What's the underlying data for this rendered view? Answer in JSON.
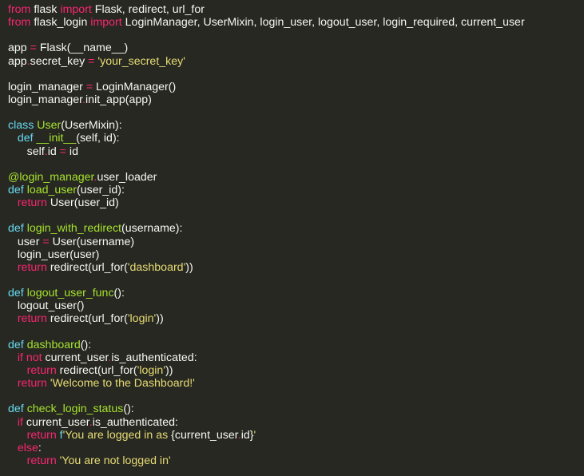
{
  "theme": {
    "background": "#272822",
    "token_colors": {
      "plain": "#f8f8f2",
      "keyword": "#f92672",
      "storage": "#66d9ef",
      "function": "#a6e22e",
      "string": "#e6db74"
    }
  },
  "code": {
    "lines": [
      [
        {
          "t": "from",
          "k": "keyword"
        },
        {
          "t": " flask ",
          "k": "plain"
        },
        {
          "t": "import",
          "k": "keyword"
        },
        {
          "t": " Flask, redirect, url_for",
          "k": "plain"
        }
      ],
      [
        {
          "t": "from",
          "k": "keyword"
        },
        {
          "t": " flask_login ",
          "k": "plain"
        },
        {
          "t": "import",
          "k": "keyword"
        },
        {
          "t": " LoginManager, UserMixin, login_user, logout_user, login_required, current_user",
          "k": "plain"
        }
      ],
      [],
      [
        {
          "t": "app ",
          "k": "plain"
        },
        {
          "t": "=",
          "k": "keyword"
        },
        {
          "t": " Flask(__name__)",
          "k": "plain"
        }
      ],
      [
        {
          "t": "app",
          "k": "plain"
        },
        {
          "t": ".",
          "k": "keyword"
        },
        {
          "t": "secret_key ",
          "k": "plain"
        },
        {
          "t": "=",
          "k": "keyword"
        },
        {
          "t": " ",
          "k": "plain"
        },
        {
          "t": "'your_secret_key'",
          "k": "string"
        }
      ],
      [],
      [
        {
          "t": "login_manager ",
          "k": "plain"
        },
        {
          "t": "=",
          "k": "keyword"
        },
        {
          "t": " LoginManager()",
          "k": "plain"
        }
      ],
      [
        {
          "t": "login_manager",
          "k": "plain"
        },
        {
          "t": ".",
          "k": "keyword"
        },
        {
          "t": "init_app(app)",
          "k": "plain"
        }
      ],
      [],
      [
        {
          "t": "class",
          "k": "storage"
        },
        {
          "t": " ",
          "k": "plain"
        },
        {
          "t": "User",
          "k": "function"
        },
        {
          "t": "(UserMixin):",
          "k": "plain"
        }
      ],
      [
        {
          "t": "   ",
          "k": "plain"
        },
        {
          "t": "def",
          "k": "storage"
        },
        {
          "t": " ",
          "k": "plain"
        },
        {
          "t": "__init__",
          "k": "function"
        },
        {
          "t": "(self, id):",
          "k": "plain"
        }
      ],
      [
        {
          "t": "      self",
          "k": "plain"
        },
        {
          "t": ".",
          "k": "keyword"
        },
        {
          "t": "id ",
          "k": "plain"
        },
        {
          "t": "=",
          "k": "keyword"
        },
        {
          "t": " id",
          "k": "plain"
        }
      ],
      [],
      [
        {
          "t": "@login_manager",
          "k": "function"
        },
        {
          "t": ".",
          "k": "keyword"
        },
        {
          "t": "user_loader",
          "k": "plain"
        }
      ],
      [
        {
          "t": "def",
          "k": "storage"
        },
        {
          "t": " ",
          "k": "plain"
        },
        {
          "t": "load_user",
          "k": "function"
        },
        {
          "t": "(user_id):",
          "k": "plain"
        }
      ],
      [
        {
          "t": "   ",
          "k": "plain"
        },
        {
          "t": "return",
          "k": "keyword"
        },
        {
          "t": " User(user_id)",
          "k": "plain"
        }
      ],
      [],
      [
        {
          "t": "def",
          "k": "storage"
        },
        {
          "t": " ",
          "k": "plain"
        },
        {
          "t": "login_with_redirect",
          "k": "function"
        },
        {
          "t": "(username):",
          "k": "plain"
        }
      ],
      [
        {
          "t": "   user ",
          "k": "plain"
        },
        {
          "t": "=",
          "k": "keyword"
        },
        {
          "t": " User(username)",
          "k": "plain"
        }
      ],
      [
        {
          "t": "   login_user(user)",
          "k": "plain"
        }
      ],
      [
        {
          "t": "   ",
          "k": "plain"
        },
        {
          "t": "return",
          "k": "keyword"
        },
        {
          "t": " redirect(url_for(",
          "k": "plain"
        },
        {
          "t": "'dashboard'",
          "k": "string"
        },
        {
          "t": "))",
          "k": "plain"
        }
      ],
      [],
      [
        {
          "t": "def",
          "k": "storage"
        },
        {
          "t": " ",
          "k": "plain"
        },
        {
          "t": "logout_user_func",
          "k": "function"
        },
        {
          "t": "():",
          "k": "plain"
        }
      ],
      [
        {
          "t": "   logout_user()",
          "k": "plain"
        }
      ],
      [
        {
          "t": "   ",
          "k": "plain"
        },
        {
          "t": "return",
          "k": "keyword"
        },
        {
          "t": " redirect(url_for(",
          "k": "plain"
        },
        {
          "t": "'login'",
          "k": "string"
        },
        {
          "t": "))",
          "k": "plain"
        }
      ],
      [],
      [
        {
          "t": "def",
          "k": "storage"
        },
        {
          "t": " ",
          "k": "plain"
        },
        {
          "t": "dashboard",
          "k": "function"
        },
        {
          "t": "():",
          "k": "plain"
        }
      ],
      [
        {
          "t": "   ",
          "k": "plain"
        },
        {
          "t": "if",
          "k": "keyword"
        },
        {
          "t": " ",
          "k": "plain"
        },
        {
          "t": "not",
          "k": "keyword"
        },
        {
          "t": " current_user",
          "k": "plain"
        },
        {
          "t": ".",
          "k": "keyword"
        },
        {
          "t": "is_authenticated:",
          "k": "plain"
        }
      ],
      [
        {
          "t": "      ",
          "k": "plain"
        },
        {
          "t": "return",
          "k": "keyword"
        },
        {
          "t": " redirect(url_for(",
          "k": "plain"
        },
        {
          "t": "'login'",
          "k": "string"
        },
        {
          "t": "))",
          "k": "plain"
        }
      ],
      [
        {
          "t": "   ",
          "k": "plain"
        },
        {
          "t": "return",
          "k": "keyword"
        },
        {
          "t": " ",
          "k": "plain"
        },
        {
          "t": "'Welcome to the Dashboard!'",
          "k": "string"
        }
      ],
      [],
      [
        {
          "t": "def",
          "k": "storage"
        },
        {
          "t": " ",
          "k": "plain"
        },
        {
          "t": "check_login_status",
          "k": "function"
        },
        {
          "t": "():",
          "k": "plain"
        }
      ],
      [
        {
          "t": "   ",
          "k": "plain"
        },
        {
          "t": "if",
          "k": "keyword"
        },
        {
          "t": " current_user",
          "k": "plain"
        },
        {
          "t": ".",
          "k": "keyword"
        },
        {
          "t": "is_authenticated:",
          "k": "plain"
        }
      ],
      [
        {
          "t": "      ",
          "k": "plain"
        },
        {
          "t": "return",
          "k": "keyword"
        },
        {
          "t": " ",
          "k": "plain"
        },
        {
          "t": "f",
          "k": "storage"
        },
        {
          "t": "'You are logged in as ",
          "k": "string"
        },
        {
          "t": "{current_user",
          "k": "plain"
        },
        {
          "t": ".",
          "k": "keyword"
        },
        {
          "t": "id}",
          "k": "plain"
        },
        {
          "t": "'",
          "k": "string"
        }
      ],
      [
        {
          "t": "   ",
          "k": "plain"
        },
        {
          "t": "else",
          "k": "keyword"
        },
        {
          "t": ":",
          "k": "plain"
        }
      ],
      [
        {
          "t": "      ",
          "k": "plain"
        },
        {
          "t": "return",
          "k": "keyword"
        },
        {
          "t": " ",
          "k": "plain"
        },
        {
          "t": "'You are not logged in'",
          "k": "string"
        }
      ]
    ]
  }
}
